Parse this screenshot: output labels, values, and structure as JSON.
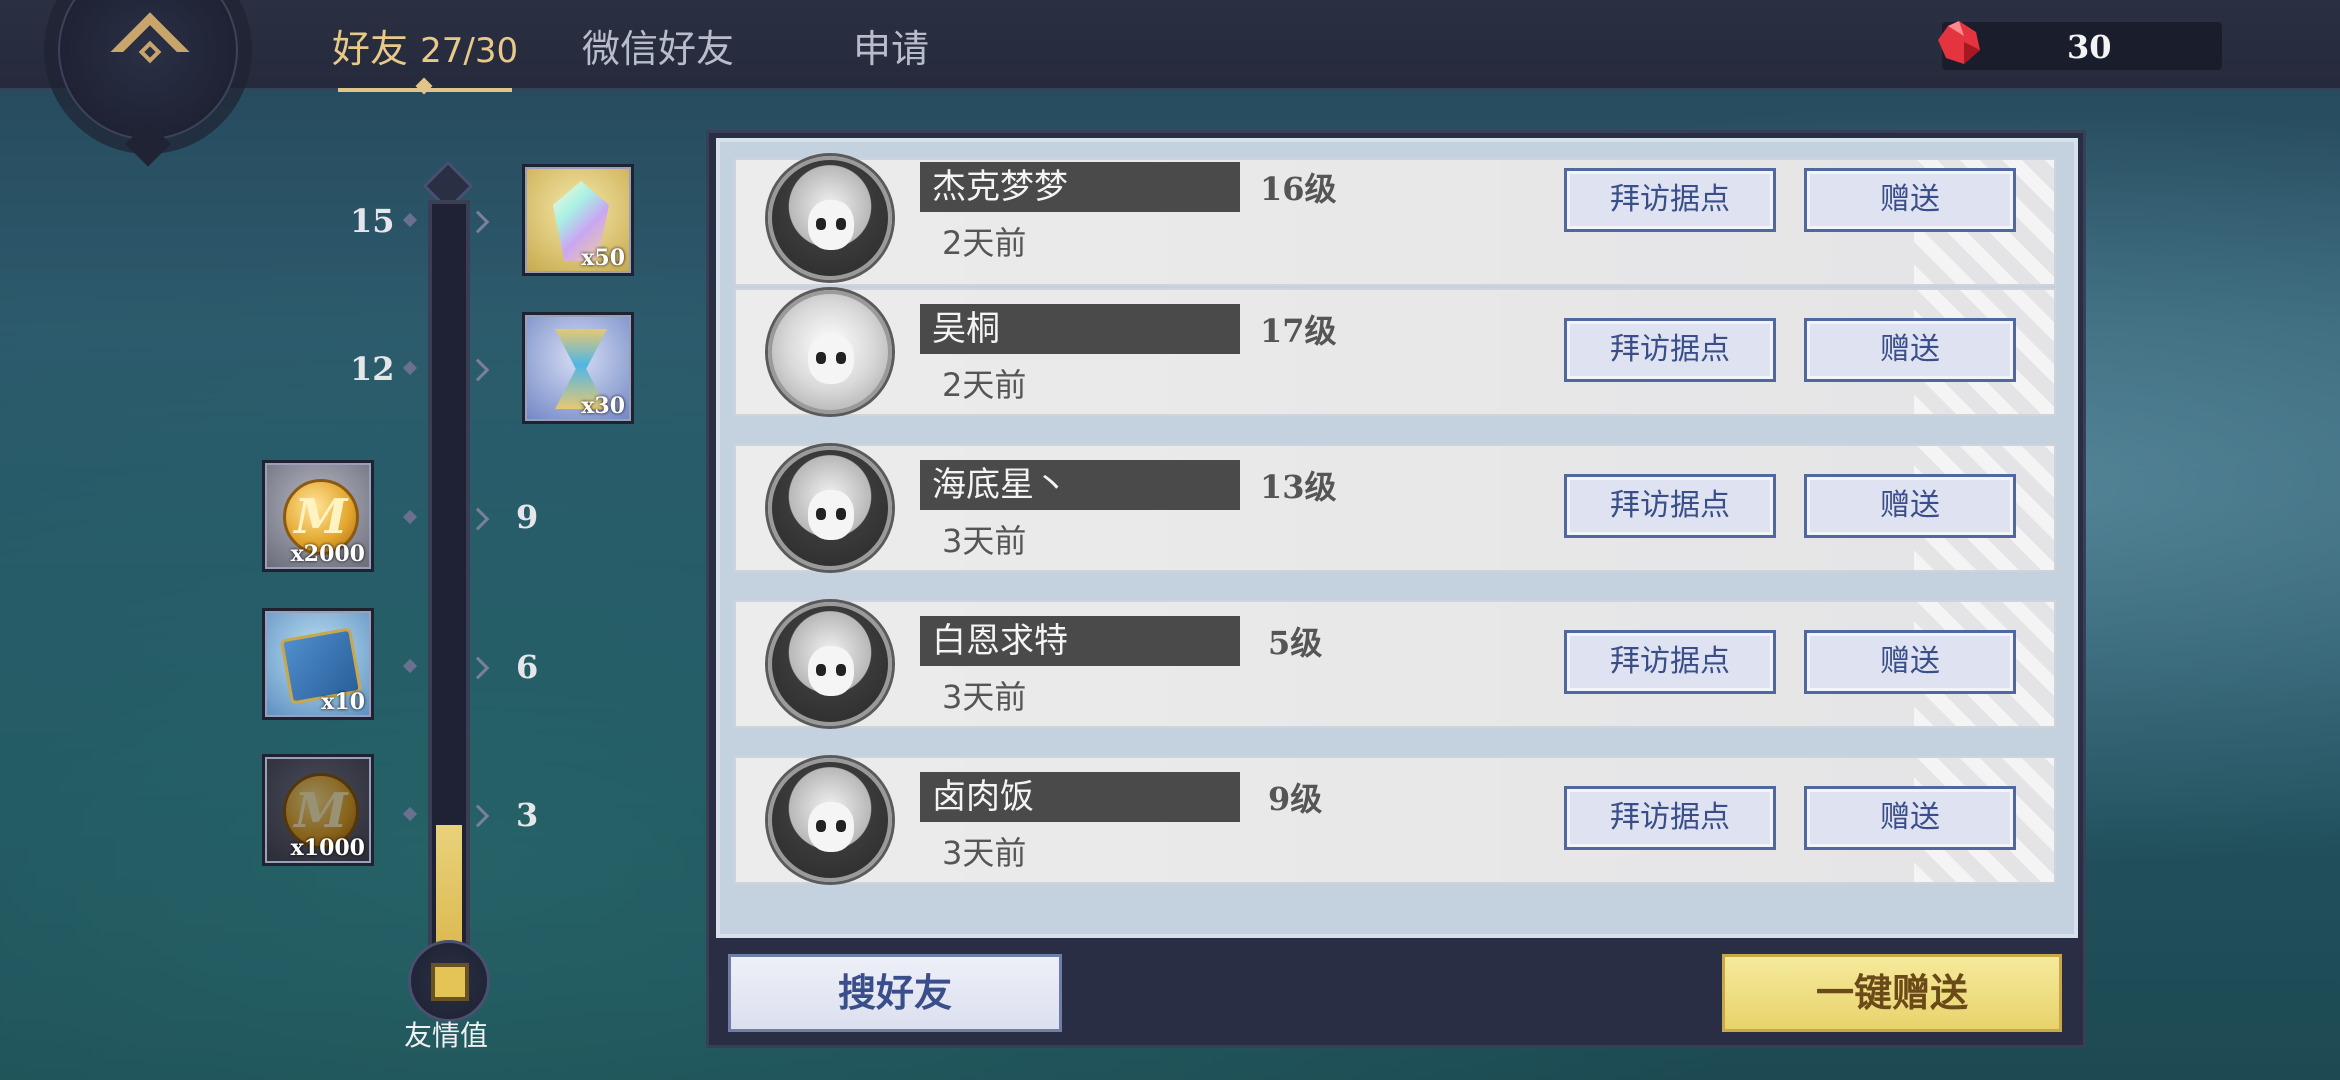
{
  "header": {
    "tabs": [
      {
        "label": "好友",
        "count": "27/30",
        "active": true
      },
      {
        "label": "微信好友",
        "active": false
      },
      {
        "label": "申请",
        "active": false
      }
    ],
    "currency": {
      "icon": "red-gem-icon",
      "value": "30"
    }
  },
  "affection": {
    "label": "友情值",
    "progress": 2,
    "max": 15,
    "milestones": [
      {
        "value": "15",
        "reward_icon": "rainbow-crystal-icon",
        "qty": "x50"
      },
      {
        "value": "12",
        "reward_icon": "hourglass-icon",
        "qty": "x30"
      },
      {
        "value": "9",
        "reward_icon": "gold-coin-icon",
        "qty": "x2000"
      },
      {
        "value": "6",
        "reward_icon": "skill-book-icon",
        "qty": "x10"
      },
      {
        "value": "3",
        "reward_icon": "gold-coin-icon",
        "qty": "x1000"
      }
    ]
  },
  "friends": [
    {
      "name": "杰克梦梦",
      "level": "16级",
      "last_seen": "2天前",
      "visit_label": "拜访据点",
      "gift_label": "赠送"
    },
    {
      "name": "吴桐",
      "level": "17级",
      "last_seen": "2天前",
      "visit_label": "拜访据点",
      "gift_label": "赠送"
    },
    {
      "name": "海底星丶",
      "level": "13级",
      "last_seen": "3天前",
      "visit_label": "拜访据点",
      "gift_label": "赠送"
    },
    {
      "name": "白恩求特",
      "level": "5级",
      "last_seen": "3天前",
      "visit_label": "拜访据点",
      "gift_label": "赠送"
    },
    {
      "name": "卤肉饭",
      "level": "9级",
      "last_seen": "3天前",
      "visit_label": "拜访据点",
      "gift_label": "赠送"
    }
  ],
  "footer": {
    "search_label": "搜好友",
    "send_all_label": "一键赠送"
  },
  "colors": {
    "accent_gold": "#e0c48a",
    "button_blue": "#3a4f8a",
    "fill_yellow": "#d9b54a"
  }
}
